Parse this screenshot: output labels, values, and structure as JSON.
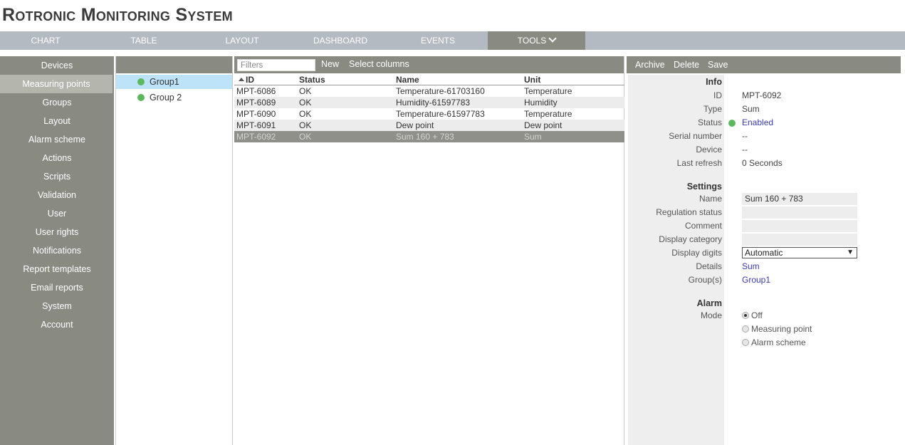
{
  "app": {
    "title": "Rotronic Monitoring System"
  },
  "topnav": {
    "tabs": [
      {
        "label": "CHART"
      },
      {
        "label": "TABLE"
      },
      {
        "label": "LAYOUT"
      },
      {
        "label": "DASHBOARD"
      },
      {
        "label": "EVENTS"
      },
      {
        "label": "TOOLS"
      }
    ],
    "active": "TOOLS"
  },
  "sidebar": {
    "items": [
      {
        "label": "Devices"
      },
      {
        "label": "Measuring points"
      },
      {
        "label": "Groups"
      },
      {
        "label": "Layout"
      },
      {
        "label": "Alarm scheme"
      },
      {
        "label": "Actions"
      },
      {
        "label": "Scripts"
      },
      {
        "label": "Validation"
      },
      {
        "label": "User"
      },
      {
        "label": "User rights"
      },
      {
        "label": "Notifications"
      },
      {
        "label": "Report templates"
      },
      {
        "label": "Email reports"
      },
      {
        "label": "System"
      },
      {
        "label": "Account"
      }
    ],
    "active": "Measuring points"
  },
  "groups": {
    "items": [
      {
        "label": "Group1",
        "status_color": "#5cb85c"
      },
      {
        "label": "Group 2",
        "status_color": "#5cb85c"
      }
    ]
  },
  "table_toolbar": {
    "filters_placeholder": "Filters",
    "new_label": "New",
    "select_columns_label": "Select columns"
  },
  "table": {
    "columns": [
      "ID",
      "Status",
      "Name",
      "Unit"
    ],
    "rows": [
      {
        "id": "MPT-6086",
        "status": "OK",
        "name": "Temperature-61703160",
        "unit": "Temperature"
      },
      {
        "id": "MPT-6089",
        "status": "OK",
        "name": "Humidity-61597783",
        "unit": "Humidity"
      },
      {
        "id": "MPT-6090",
        "status": "OK",
        "name": "Temperature-61597783",
        "unit": "Temperature"
      },
      {
        "id": "MPT-6091",
        "status": "OK",
        "name": "Dew point",
        "unit": "Dew point"
      },
      {
        "id": "MPT-6092",
        "status": "OK",
        "name": "Sum 160 + 783",
        "unit": "Sum"
      }
    ]
  },
  "detail_toolbar": {
    "archive_label": "Archive",
    "delete_label": "Delete",
    "save_label": "Save"
  },
  "detail": {
    "info_title": "Info",
    "id_label": "ID",
    "id_value": "MPT-6092",
    "type_label": "Type",
    "type_value": "Sum",
    "status_label": "Status",
    "status_value": "Enabled",
    "status_color": "#5cb85c",
    "serial_label": "Serial number",
    "serial_value": "--",
    "device_label": "Device",
    "device_value": "--",
    "refresh_label": "Last refresh",
    "refresh_value": "0 Seconds",
    "settings_title": "Settings",
    "name_label": "Name",
    "name_value": "Sum 160 + 783",
    "regulation_label": "Regulation status",
    "regulation_value": "",
    "comment_label": "Comment",
    "comment_value": "",
    "category_label": "Display category",
    "category_value": "",
    "digits_label": "Display digits",
    "digits_value": "Automatic",
    "details_label": "Details",
    "details_value": "Sum",
    "groups_label": "Group(s)",
    "groups_value": "Group1",
    "alarm_title": "Alarm",
    "mode_label": "Mode",
    "mode_options": [
      "Off",
      "Measuring point",
      "Alarm scheme"
    ],
    "mode_selected": "Off"
  },
  "colors": {
    "nav_bg": "#b3bac1",
    "panel_header": "#898a82",
    "selected_group": "#bde3f8",
    "selected_row": "#8f908a",
    "link": "#3a3ab0",
    "ok_green": "#5cb85c"
  }
}
